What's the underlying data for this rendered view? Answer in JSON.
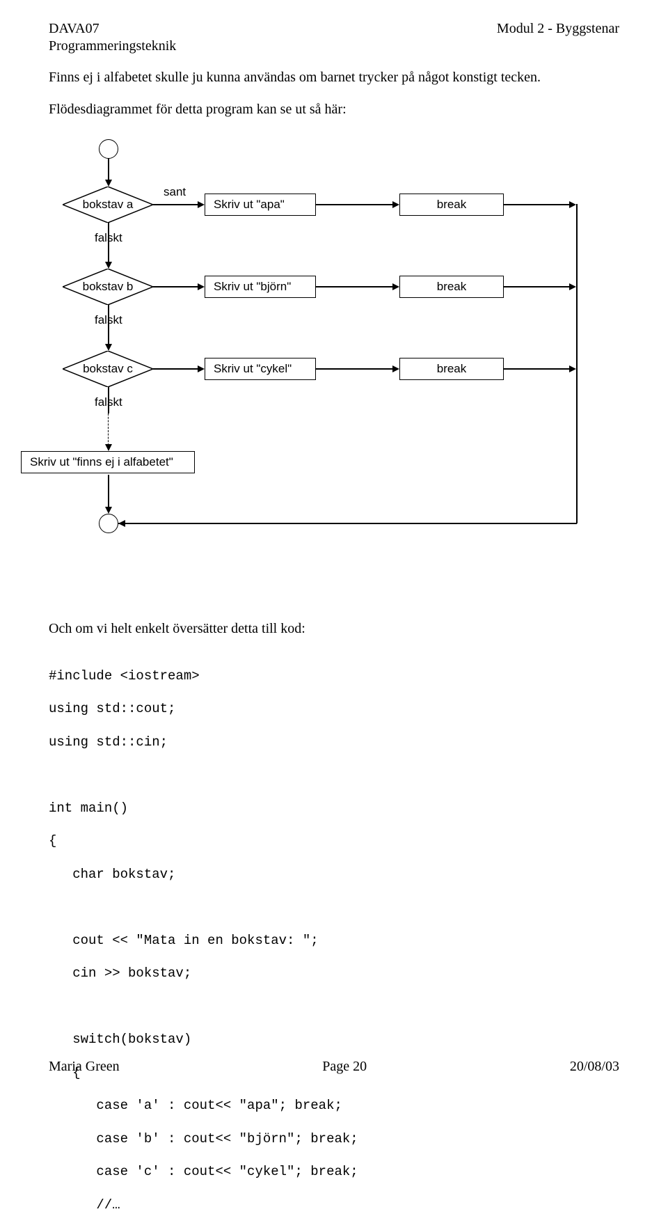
{
  "header": {
    "left": "DAVA07",
    "right": "Modul 2 - Byggstenar",
    "sub": "Programmeringsteknik"
  },
  "paragraphs": {
    "p1": "Finns ej i alfabetet skulle ju kunna användas om barnet trycker på något konstigt tecken.",
    "p2": "Flödesdiagrammet för detta program kan se ut så här:",
    "p3": "Och om vi helt enkelt översätter detta till kod:"
  },
  "diagram": {
    "sant": "sant",
    "falskt1": "falskt",
    "falskt2": "falskt",
    "falskt3": "falskt",
    "diamond_a": "bokstav a",
    "diamond_b": "bokstav b",
    "diamond_c": "bokstav c",
    "skriv_a": "Skriv ut \"apa\"",
    "skriv_b": "Skriv ut \"björn\"",
    "skriv_c": "Skriv ut \"cykel\"",
    "break_a": "break",
    "break_b": "break",
    "break_c": "break",
    "default_box": "Skriv ut \"finns ej i alfabetet\""
  },
  "code": {
    "l1": "#include <iostream>",
    "l2": "using std::cout;",
    "l3": "using std::cin;",
    "l4": "",
    "l5": "int main()",
    "l6": "{",
    "l7": "   char bokstav;",
    "l8": "",
    "l9": "   cout << \"Mata in en bokstav: \";",
    "l10": "   cin >> bokstav;",
    "l11": "",
    "l12": "   switch(bokstav)",
    "l13": "   {",
    "l14": "      case 'a' : cout<< \"apa\"; break;",
    "l15": "      case 'b' : cout<< \"björn\"; break;",
    "l16": "      case 'c' : cout<< \"cykel\"; break;",
    "l17": "      //…"
  },
  "footer": {
    "left": "Maria Green",
    "center": "Page 20",
    "right": "20/08/03"
  }
}
